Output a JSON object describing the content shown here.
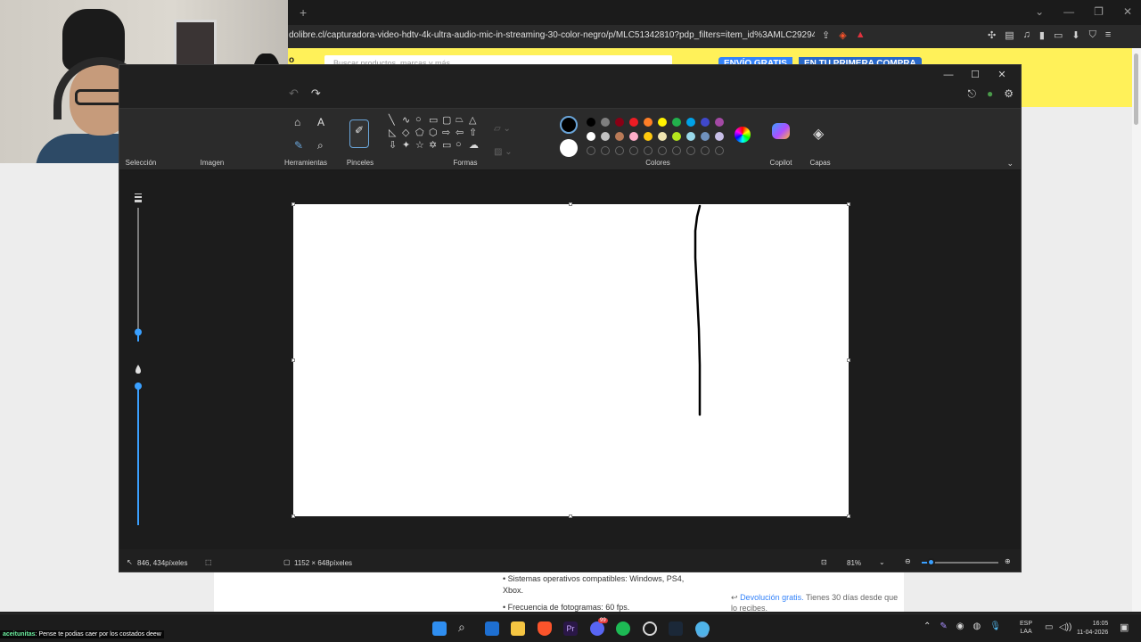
{
  "browser": {
    "new_tab": "+",
    "url": "dolibre.cl/capturadora-video-hdtv-4k-ultra-audio-mic-in-streaming-30-color-negro/p/MLC51342810?pdp_filters=item_id%3AMLC2929439280..."
  },
  "webpage": {
    "logo": "o",
    "search_placeholder": "Buscar productos, marcas y más...",
    "envio_badge": "ENVÍO GRATIS",
    "envio_badge_tail": "EN TU PRIMERA COMPRA",
    "spec_os": "Sistemas operativos compatibles: Windows, PS4, Xbox.",
    "spec_fps": "Frecuencia de fotogramas: 60 fps.",
    "return_link": "Devolución gratis.",
    "return_text": " Tienes 30 días desde que lo recibes."
  },
  "paint": {
    "ribbon": {
      "seleccion": "Selección",
      "imagen": "Imagen",
      "herramientas": "Herramientas",
      "pinceles": "Pinceles",
      "formas": "Formas",
      "colores": "Colores",
      "copilot": "Copilot",
      "capas": "Capas"
    },
    "colors": {
      "primary": "#000000",
      "secondary": "#ffffff",
      "row1": [
        "#000000",
        "#7f7f7f",
        "#880015",
        "#ed1c24",
        "#ff7f27",
        "#fff200",
        "#22b14c",
        "#00a2e8",
        "#3f48cc",
        "#a349a4"
      ],
      "row2": [
        "#ffffff",
        "#c3c3c3",
        "#b97a57",
        "#ffaec9",
        "#ffc90e",
        "#efe4b0",
        "#b5e61d",
        "#99d9ea",
        "#7092be",
        "#c8bfe7"
      ]
    },
    "brush_size_fraction": 0.93,
    "opacity_fraction": 1.0,
    "status": {
      "cursor_pos": "846, 434píxeles",
      "canvas_size": "1152 × 648píxeles",
      "zoom": "81%",
      "zoom_fraction": 0.12
    }
  },
  "chat": {
    "user": "aceitunitas",
    "message": ": Pense  te podias caer por los costados deew"
  },
  "taskbar": {
    "lang_top": "ESP",
    "lang_bottom": "LAA",
    "time": "16:05",
    "date": "11-04-2026",
    "discord_badge": "99"
  }
}
